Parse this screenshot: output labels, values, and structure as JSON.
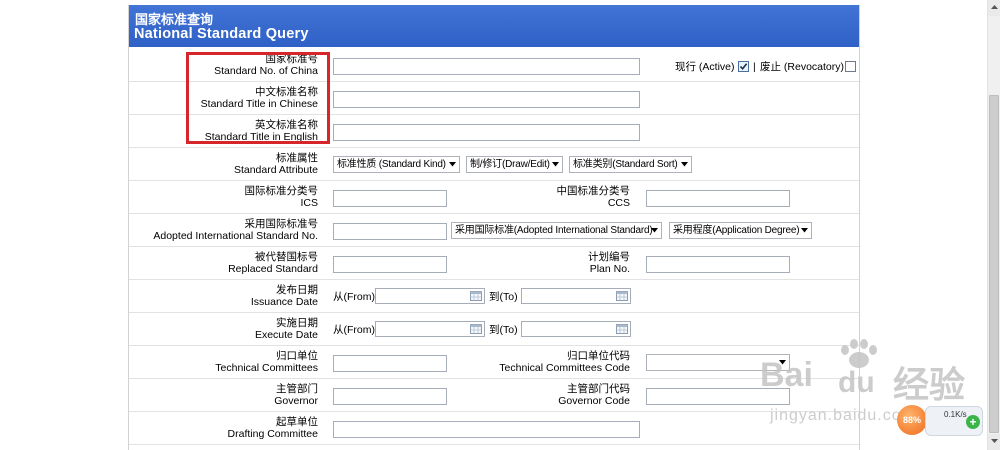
{
  "header": {
    "title_cn": "国家标准查询",
    "title_en": "National Standard Query"
  },
  "colors": {
    "header_bg": "#3568cc",
    "annotation": "#d6262b",
    "input_border": "#a6adb8"
  },
  "fields": {
    "standard_no": {
      "label_cn": "国家标准号",
      "label_en": "Standard No. of China",
      "value": ""
    },
    "status": {
      "active_label": "现行 (Active)",
      "active_checked": true,
      "separator": "|",
      "revoked_label": "废止 (Revocatory)",
      "revoked_checked": false
    },
    "title_cn": {
      "label_cn": "中文标准名称",
      "label_en": "Standard Title in Chinese",
      "value": ""
    },
    "title_en": {
      "label_cn": "英文标准名称",
      "label_en": "Standard Title in English",
      "value": ""
    },
    "attribute": {
      "label_cn": "标准属性",
      "label_en": "Standard Attribute",
      "kind_select": "标准性质 (Standard Kind)",
      "draw_edit_select": "制/修订(Draw/Edit)",
      "sort_select": "标准类别(Standard Sort)"
    },
    "ics": {
      "label_cn": "国际标准分类号",
      "label_en": "ICS",
      "value": ""
    },
    "ccs": {
      "label_cn": "中国标准分类号",
      "label_en": "CCS",
      "value": ""
    },
    "adopted": {
      "label_cn": "采用国际标准号",
      "label_en": "Adopted International Standard No.",
      "value": "",
      "standard_select": "采用国际标准(Adopted International Standard)",
      "degree_select": "采用程度(Application Degree)"
    },
    "replaced": {
      "label_cn": "被代替国标号",
      "label_en": "Replaced Standard",
      "value": ""
    },
    "plan_no": {
      "label_cn": "计划编号",
      "label_en": "Plan No.",
      "value": ""
    },
    "issuance_date": {
      "label_cn": "发布日期",
      "label_en": "Issuance Date",
      "from_label": "从(From)",
      "to_label": "到(To)"
    },
    "execute_date": {
      "label_cn": "实施日期",
      "label_en": "Execute Date",
      "from_label": "从(From)",
      "to_label": "到(To)"
    },
    "tech_committees": {
      "label_cn": "归口单位",
      "label_en": "Technical Committees",
      "value": ""
    },
    "tech_committees_code": {
      "label_cn": "归口单位代码",
      "label_en": "Technical Committees Code",
      "value": ""
    },
    "governor": {
      "label_cn": "主管部门",
      "label_en": "Governor",
      "value": ""
    },
    "governor_code": {
      "label_cn": "主管部门代码",
      "label_en": "Governor Code",
      "value": ""
    },
    "drafting": {
      "label_cn": "起草单位",
      "label_en": "Drafting Committee",
      "value": ""
    }
  },
  "icons": {
    "checkbox": "checkmark-icon",
    "dropdown": "chevron-down-icon",
    "date_picker": "calendar-icon",
    "logo": "paw-icon"
  },
  "watermark": {
    "logo_left": "Bai",
    "logo_right": "du",
    "logo_cn": "经验",
    "url": "jingyan.baidu.com"
  },
  "widget": {
    "percent": "88%",
    "speed": "0.1K/s"
  }
}
